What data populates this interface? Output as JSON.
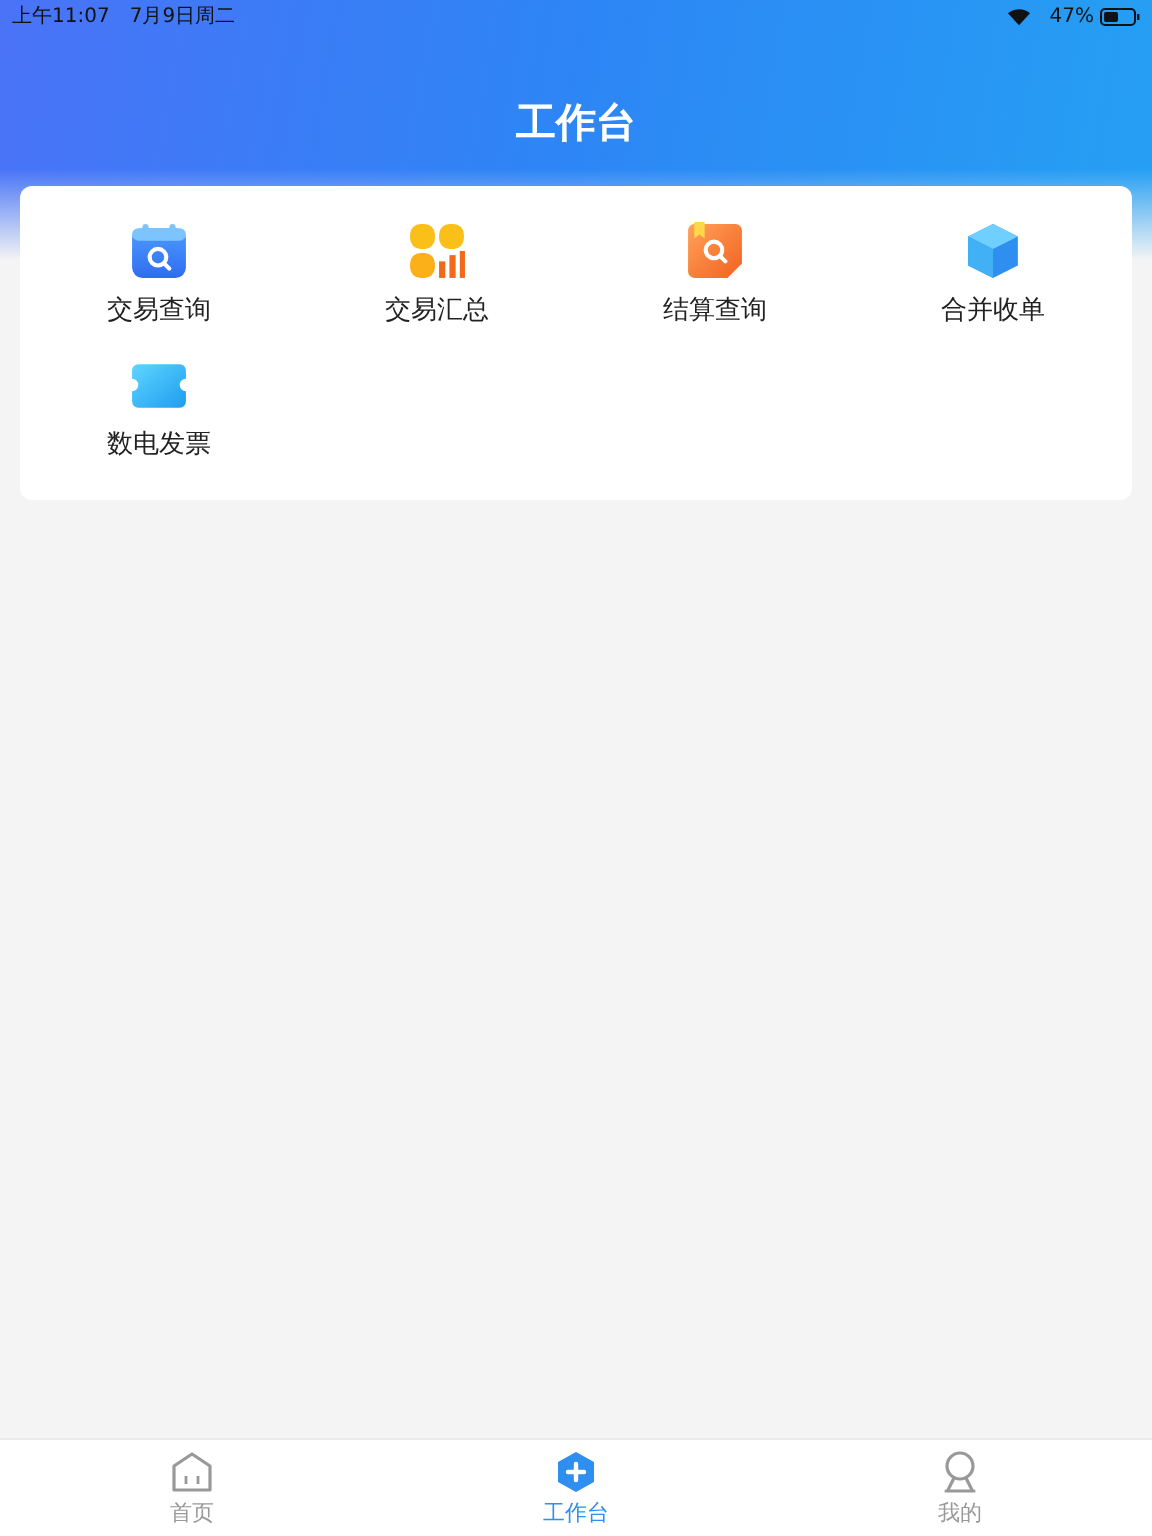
{
  "status_bar": {
    "time": "上午11:07",
    "date": "7月9日周二",
    "battery": "47%"
  },
  "header": {
    "title": "工作台"
  },
  "tiles": [
    {
      "kind": "calendar-search",
      "label": "交易查询"
    },
    {
      "kind": "grid-chart",
      "label": "交易汇总"
    },
    {
      "kind": "book-search",
      "label": "结算查询"
    },
    {
      "kind": "cube",
      "label": "合并收单"
    },
    {
      "kind": "ticket",
      "label": "数电发票"
    }
  ],
  "tab_bar": [
    {
      "kind": "home",
      "label": "首页",
      "selected": false
    },
    {
      "kind": "plus",
      "label": "工作台",
      "selected": true
    },
    {
      "kind": "person",
      "label": "我的",
      "selected": false
    }
  ]
}
